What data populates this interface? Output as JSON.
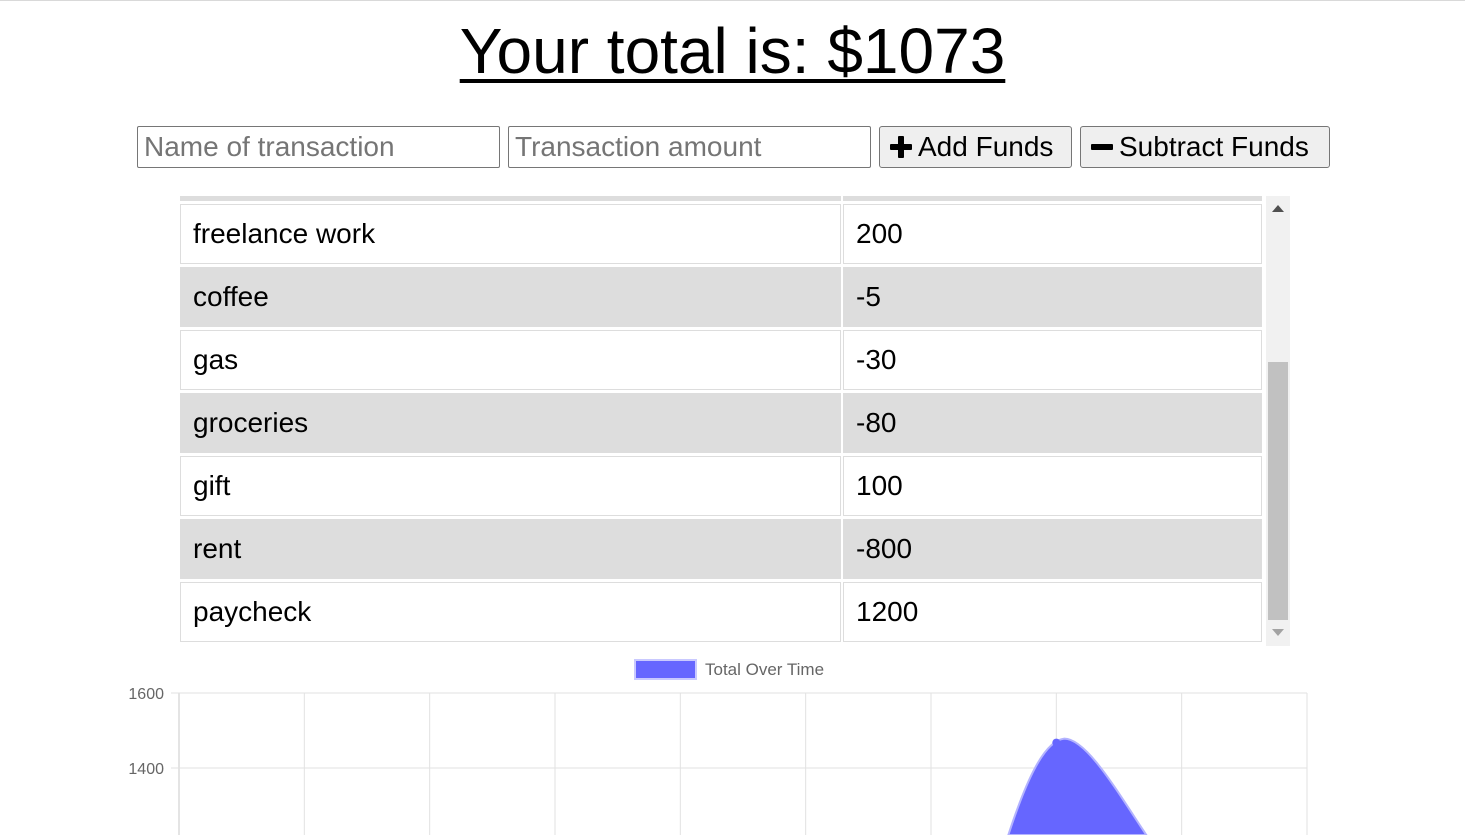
{
  "header": {
    "total_title": "Your total is: $1073"
  },
  "form": {
    "name_placeholder": "Name of transaction",
    "amount_placeholder": "Transaction amount",
    "add_label": "Add Funds",
    "subtract_label": "Subtract Funds",
    "add_icon": "plus-icon",
    "subtract_icon": "minus-icon"
  },
  "transactions": [
    {
      "name": "",
      "amount": ""
    },
    {
      "name": "freelance work",
      "amount": "200"
    },
    {
      "name": "coffee",
      "amount": "-5"
    },
    {
      "name": "gas",
      "amount": "-30"
    },
    {
      "name": "groceries",
      "amount": "-80"
    },
    {
      "name": "gift",
      "amount": "100"
    },
    {
      "name": "rent",
      "amount": "-800"
    },
    {
      "name": "paycheck",
      "amount": "1200"
    }
  ],
  "chart_data": {
    "type": "area",
    "title": "",
    "xlabel": "",
    "ylabel": "",
    "series": [
      {
        "name": "Total Over Time",
        "color": "#6666ff",
        "points": [
          [
            7.0,
            1473
          ]
        ]
      }
    ],
    "y_ticks_visible": [
      "1600",
      "1400"
    ],
    "ylim": [
      null,
      1600
    ],
    "x_grid_columns": 9,
    "grid": true,
    "legend_position": "top-center"
  }
}
